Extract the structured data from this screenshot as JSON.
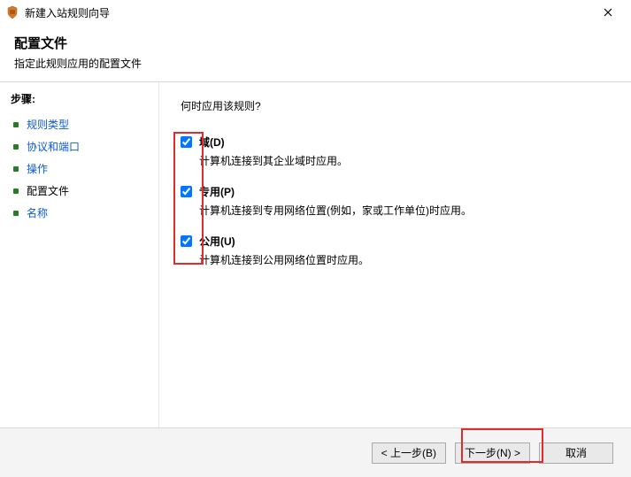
{
  "window": {
    "title": "新建入站规则向导"
  },
  "header": {
    "title": "配置文件",
    "subtitle": "指定此规则应用的配置文件"
  },
  "sidebar": {
    "label": "步骤:",
    "steps": [
      {
        "label": "规则类型"
      },
      {
        "label": "协议和端口"
      },
      {
        "label": "操作"
      },
      {
        "label": "配置文件"
      },
      {
        "label": "名称"
      }
    ]
  },
  "content": {
    "question": "何时应用该规则?",
    "options": [
      {
        "label": "域(D)",
        "desc": "计算机连接到其企业域时应用。",
        "checked": true
      },
      {
        "label": "专用(P)",
        "desc": "计算机连接到专用网络位置(例如，家或工作单位)时应用。",
        "checked": true
      },
      {
        "label": "公用(U)",
        "desc": "计算机连接到公用网络位置时应用。",
        "checked": true
      }
    ]
  },
  "footer": {
    "back": "< 上一步(B)",
    "next": "下一步(N) >",
    "cancel": "取消"
  }
}
